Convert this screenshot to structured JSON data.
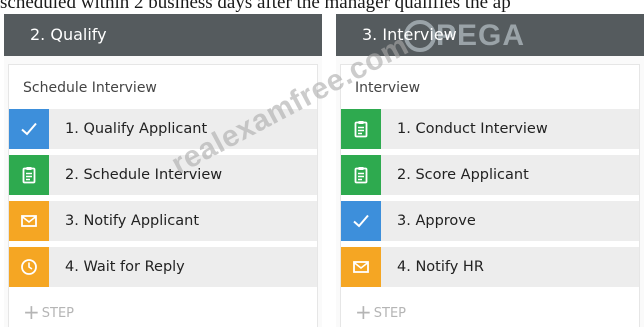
{
  "top_text": "scheduled within 2 business days after the manager qualifies the ap",
  "watermark": "realexamfree.com",
  "brand": "PEGA",
  "stages": [
    {
      "title": "2. Qualify",
      "process": "Schedule Interview",
      "steps": [
        {
          "label": "1.  Qualify Applicant",
          "icon": "check-icon",
          "color": "#3d8fdb"
        },
        {
          "label": "2.  Schedule Interview",
          "icon": "clipboard-icon",
          "color": "#2eaa4f"
        },
        {
          "label": "3.  Notify Applicant",
          "icon": "envelope-icon",
          "color": "#f5a623"
        },
        {
          "label": "4.  Wait for Reply",
          "icon": "clock-icon",
          "color": "#f5a623"
        }
      ],
      "add_step": "STEP"
    },
    {
      "title": "3. Interview",
      "process": "Interview",
      "steps": [
        {
          "label": "1.  Conduct Interview",
          "icon": "clipboard-icon",
          "color": "#2eaa4f"
        },
        {
          "label": "2.  Score Applicant",
          "icon": "clipboard-icon",
          "color": "#2eaa4f"
        },
        {
          "label": "3.  Approve",
          "icon": "check-icon",
          "color": "#3d8fdb"
        },
        {
          "label": "4.  Notify HR",
          "icon": "envelope-icon",
          "color": "#f5a623"
        }
      ],
      "add_step": "STEP"
    }
  ]
}
